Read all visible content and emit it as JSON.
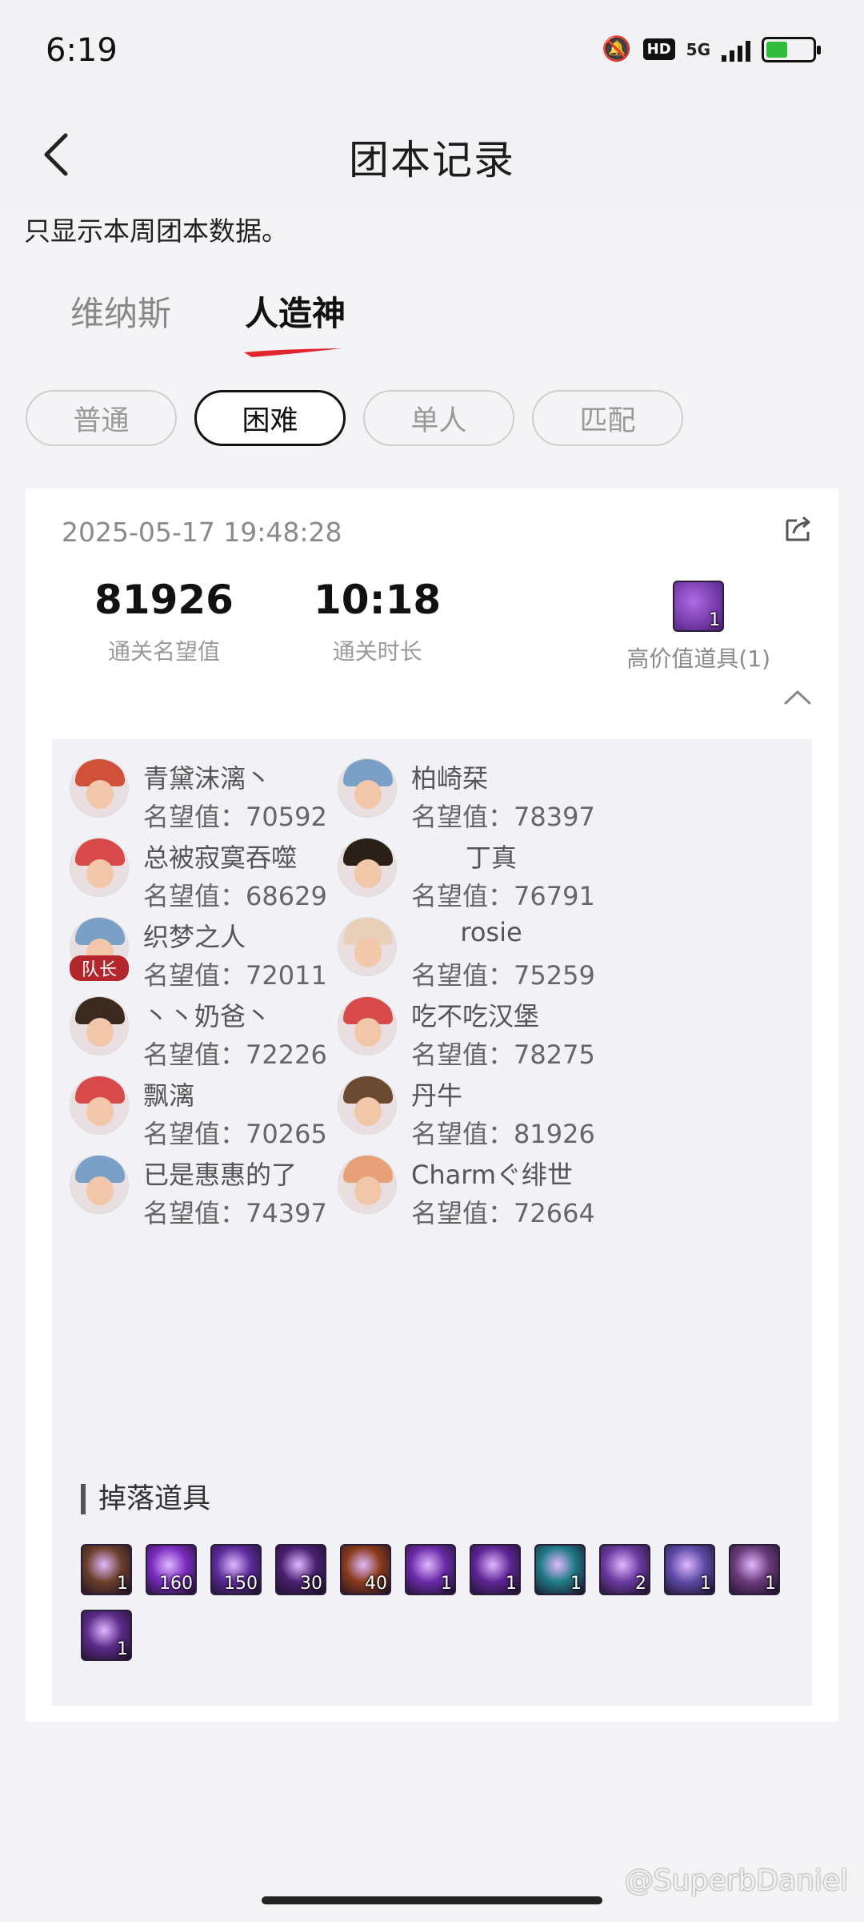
{
  "status_bar": {
    "time": "6:19",
    "network": "5G",
    "hd_label": "HD"
  },
  "header": {
    "title": "团本记录"
  },
  "notice": "只显示本周团本数据。",
  "tabs": [
    {
      "label": "维纳斯",
      "active": false
    },
    {
      "label": "人造神",
      "active": true
    }
  ],
  "filters": [
    {
      "label": "普通",
      "active": false
    },
    {
      "label": "困难",
      "active": true
    },
    {
      "label": "单人",
      "active": false
    },
    {
      "label": "匹配",
      "active": false
    }
  ],
  "record": {
    "timestamp": "2025-05-17 19:48:28",
    "fame_value": "81926",
    "fame_label": "通关名望值",
    "clear_time_value": "10:18",
    "clear_time_label": "通关时长",
    "valuable_label": "高价值道具(1)",
    "valuable_count": "1",
    "fame_prefix": "名望值：",
    "leader_label": "队长",
    "members": [
      {
        "name": "青黛沫漓丶",
        "fame": "70592"
      },
      {
        "name": "柏崎栞",
        "fame": "78397"
      },
      {
        "name": "总被寂寞吞噬",
        "fame": "68629"
      },
      {
        "name": "丁真",
        "fame": "76791"
      },
      {
        "name": "织梦之人",
        "fame": "72011"
      },
      {
        "name": "rosie",
        "fame": "75259"
      },
      {
        "name": "丶丶奶爸丶",
        "fame": "72226"
      },
      {
        "name": "吃不吃汉堡",
        "fame": "78275"
      },
      {
        "name": "飘漓",
        "fame": "70265"
      },
      {
        "name": "丹牛",
        "fame": "81926"
      },
      {
        "name": "已是惠惠的了",
        "fame": "74397"
      },
      {
        "name": "Charmぐ绯世",
        "fame": "72664"
      }
    ],
    "drops_title": "掉落道具",
    "drops": [
      {
        "count": "1",
        "color": "#6b3f2a"
      },
      {
        "count": "160",
        "color": "#7a2bbf"
      },
      {
        "count": "150",
        "color": "#5b2a9a"
      },
      {
        "count": "30",
        "color": "#4a1f70"
      },
      {
        "count": "40",
        "color": "#8a3a1a"
      },
      {
        "count": "1",
        "color": "#6a2aa8"
      },
      {
        "count": "1",
        "color": "#5e2596"
      },
      {
        "count": "1",
        "color": "#1f7a86"
      },
      {
        "count": "2",
        "color": "#6b3aa0"
      },
      {
        "count": "1",
        "color": "#5d4aa6"
      },
      {
        "count": "1",
        "color": "#6a3a7a"
      },
      {
        "count": "1",
        "color": "#5a2a88"
      }
    ]
  },
  "watermark": "@SuperbDaniel"
}
